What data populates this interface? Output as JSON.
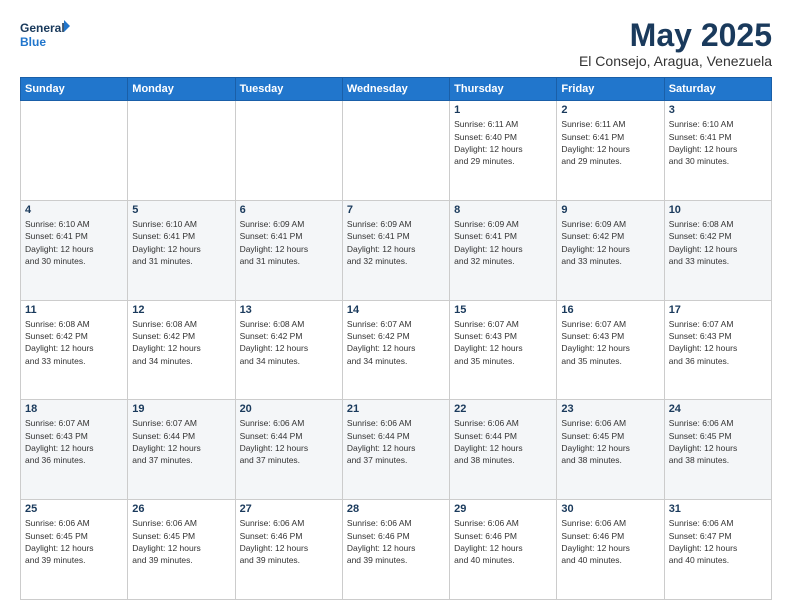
{
  "header": {
    "logo_line1": "General",
    "logo_line2": "Blue",
    "month": "May 2025",
    "location": "El Consejo, Aragua, Venezuela"
  },
  "days_of_week": [
    "Sunday",
    "Monday",
    "Tuesday",
    "Wednesday",
    "Thursday",
    "Friday",
    "Saturday"
  ],
  "weeks": [
    [
      {
        "day": "",
        "info": ""
      },
      {
        "day": "",
        "info": ""
      },
      {
        "day": "",
        "info": ""
      },
      {
        "day": "",
        "info": ""
      },
      {
        "day": "1",
        "info": "Sunrise: 6:11 AM\nSunset: 6:40 PM\nDaylight: 12 hours\nand 29 minutes."
      },
      {
        "day": "2",
        "info": "Sunrise: 6:11 AM\nSunset: 6:41 PM\nDaylight: 12 hours\nand 29 minutes."
      },
      {
        "day": "3",
        "info": "Sunrise: 6:10 AM\nSunset: 6:41 PM\nDaylight: 12 hours\nand 30 minutes."
      }
    ],
    [
      {
        "day": "4",
        "info": "Sunrise: 6:10 AM\nSunset: 6:41 PM\nDaylight: 12 hours\nand 30 minutes."
      },
      {
        "day": "5",
        "info": "Sunrise: 6:10 AM\nSunset: 6:41 PM\nDaylight: 12 hours\nand 31 minutes."
      },
      {
        "day": "6",
        "info": "Sunrise: 6:09 AM\nSunset: 6:41 PM\nDaylight: 12 hours\nand 31 minutes."
      },
      {
        "day": "7",
        "info": "Sunrise: 6:09 AM\nSunset: 6:41 PM\nDaylight: 12 hours\nand 32 minutes."
      },
      {
        "day": "8",
        "info": "Sunrise: 6:09 AM\nSunset: 6:41 PM\nDaylight: 12 hours\nand 32 minutes."
      },
      {
        "day": "9",
        "info": "Sunrise: 6:09 AM\nSunset: 6:42 PM\nDaylight: 12 hours\nand 33 minutes."
      },
      {
        "day": "10",
        "info": "Sunrise: 6:08 AM\nSunset: 6:42 PM\nDaylight: 12 hours\nand 33 minutes."
      }
    ],
    [
      {
        "day": "11",
        "info": "Sunrise: 6:08 AM\nSunset: 6:42 PM\nDaylight: 12 hours\nand 33 minutes."
      },
      {
        "day": "12",
        "info": "Sunrise: 6:08 AM\nSunset: 6:42 PM\nDaylight: 12 hours\nand 34 minutes."
      },
      {
        "day": "13",
        "info": "Sunrise: 6:08 AM\nSunset: 6:42 PM\nDaylight: 12 hours\nand 34 minutes."
      },
      {
        "day": "14",
        "info": "Sunrise: 6:07 AM\nSunset: 6:42 PM\nDaylight: 12 hours\nand 34 minutes."
      },
      {
        "day": "15",
        "info": "Sunrise: 6:07 AM\nSunset: 6:43 PM\nDaylight: 12 hours\nand 35 minutes."
      },
      {
        "day": "16",
        "info": "Sunrise: 6:07 AM\nSunset: 6:43 PM\nDaylight: 12 hours\nand 35 minutes."
      },
      {
        "day": "17",
        "info": "Sunrise: 6:07 AM\nSunset: 6:43 PM\nDaylight: 12 hours\nand 36 minutes."
      }
    ],
    [
      {
        "day": "18",
        "info": "Sunrise: 6:07 AM\nSunset: 6:43 PM\nDaylight: 12 hours\nand 36 minutes."
      },
      {
        "day": "19",
        "info": "Sunrise: 6:07 AM\nSunset: 6:44 PM\nDaylight: 12 hours\nand 37 minutes."
      },
      {
        "day": "20",
        "info": "Sunrise: 6:06 AM\nSunset: 6:44 PM\nDaylight: 12 hours\nand 37 minutes."
      },
      {
        "day": "21",
        "info": "Sunrise: 6:06 AM\nSunset: 6:44 PM\nDaylight: 12 hours\nand 37 minutes."
      },
      {
        "day": "22",
        "info": "Sunrise: 6:06 AM\nSunset: 6:44 PM\nDaylight: 12 hours\nand 38 minutes."
      },
      {
        "day": "23",
        "info": "Sunrise: 6:06 AM\nSunset: 6:45 PM\nDaylight: 12 hours\nand 38 minutes."
      },
      {
        "day": "24",
        "info": "Sunrise: 6:06 AM\nSunset: 6:45 PM\nDaylight: 12 hours\nand 38 minutes."
      }
    ],
    [
      {
        "day": "25",
        "info": "Sunrise: 6:06 AM\nSunset: 6:45 PM\nDaylight: 12 hours\nand 39 minutes."
      },
      {
        "day": "26",
        "info": "Sunrise: 6:06 AM\nSunset: 6:45 PM\nDaylight: 12 hours\nand 39 minutes."
      },
      {
        "day": "27",
        "info": "Sunrise: 6:06 AM\nSunset: 6:46 PM\nDaylight: 12 hours\nand 39 minutes."
      },
      {
        "day": "28",
        "info": "Sunrise: 6:06 AM\nSunset: 6:46 PM\nDaylight: 12 hours\nand 39 minutes."
      },
      {
        "day": "29",
        "info": "Sunrise: 6:06 AM\nSunset: 6:46 PM\nDaylight: 12 hours\nand 40 minutes."
      },
      {
        "day": "30",
        "info": "Sunrise: 6:06 AM\nSunset: 6:46 PM\nDaylight: 12 hours\nand 40 minutes."
      },
      {
        "day": "31",
        "info": "Sunrise: 6:06 AM\nSunset: 6:47 PM\nDaylight: 12 hours\nand 40 minutes."
      }
    ]
  ]
}
